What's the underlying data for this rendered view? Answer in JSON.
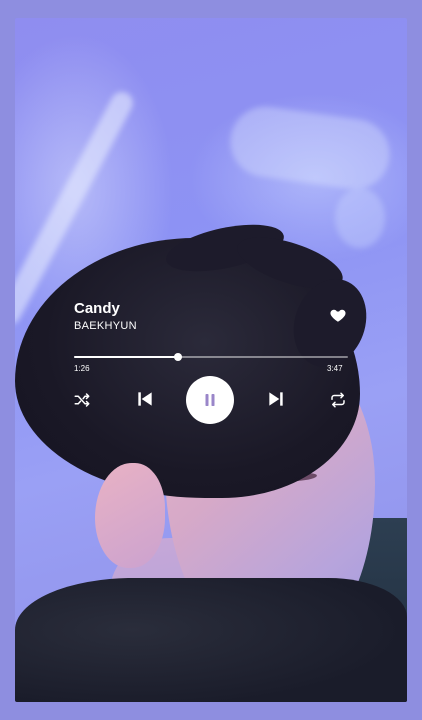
{
  "track": {
    "title": "Candy",
    "artist": "BAEKHYUN",
    "elapsed": "1:26",
    "duration": "3:47",
    "progress": 0.38,
    "liked": true,
    "is_playing": true
  },
  "controls": {
    "shuffle_icon": "shuffle-icon",
    "previous_icon": "skip-previous-icon",
    "play_pause_icon": "pause-icon",
    "next_icon": "skip-next-icon",
    "repeat_icon": "repeat-icon",
    "like_icon": "heart-icon"
  },
  "colors": {
    "frame_background": "#8e8ee0",
    "text": "#ffffff",
    "pause_glyph": "#9a86c9"
  }
}
